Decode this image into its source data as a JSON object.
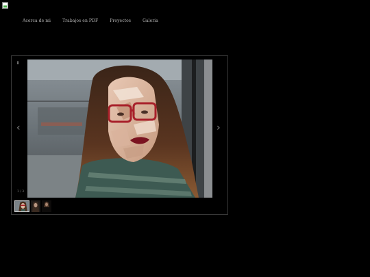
{
  "nav": {
    "items": [
      "Acerca de mi",
      "Trabajos en PDF",
      "Proyectos",
      "Galeria"
    ]
  },
  "gallery": {
    "info_label": "i",
    "prev_glyph": "‹",
    "next_glyph": "›",
    "counter": "1 / 3",
    "thumbnail_count": 3,
    "active_index": 0
  },
  "colors": {
    "background": "#000000",
    "nav_text": "#b9b9b9",
    "frame_border": "#3a3a3a"
  }
}
